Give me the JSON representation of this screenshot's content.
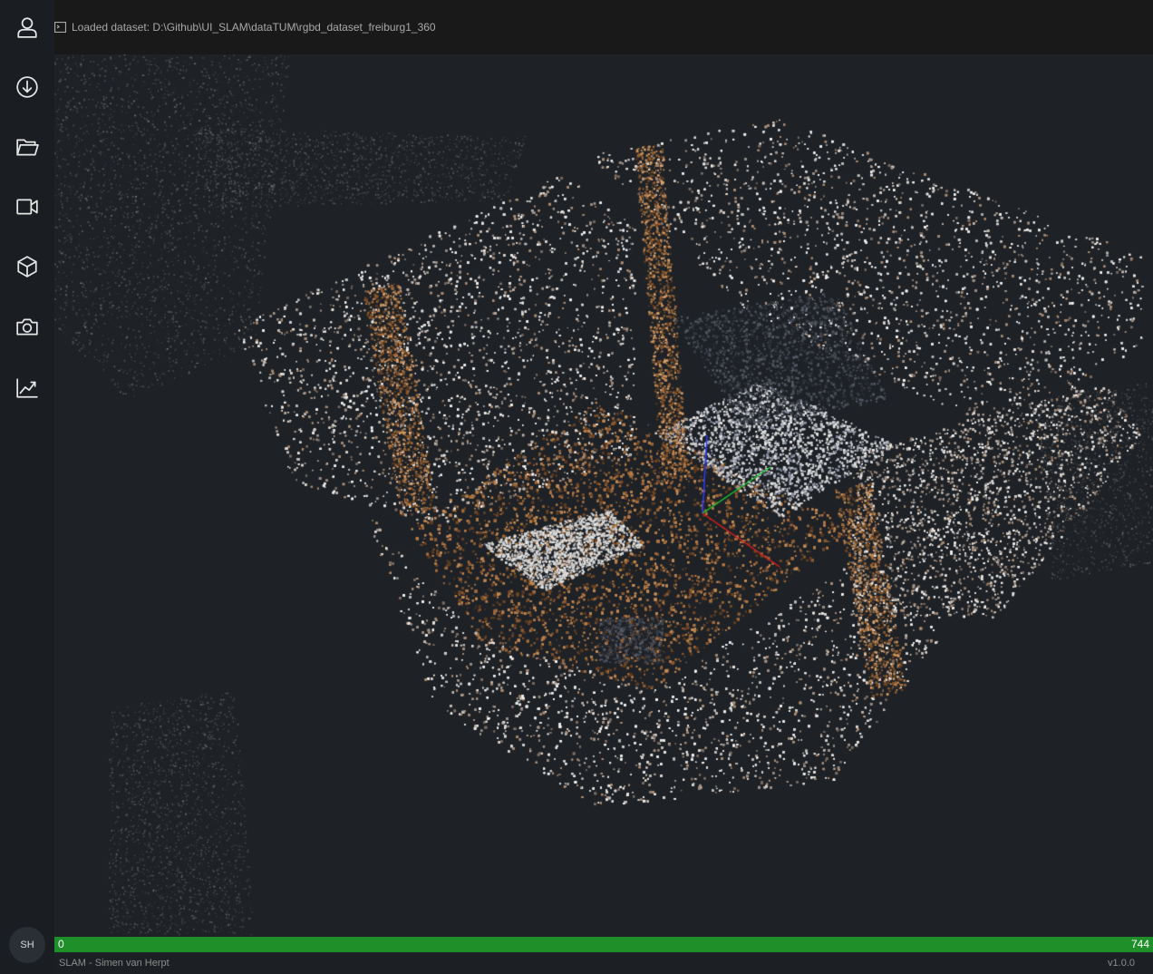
{
  "status": {
    "text": "Loaded dataset: D:\\Github\\UI_SLAM\\dataTUM\\rgbd_dataset_freiburg1_360",
    "icon": "terminal-icon"
  },
  "sidebar": {
    "items": [
      {
        "name": "user-icon"
      },
      {
        "name": "download-icon"
      },
      {
        "name": "folder-open-icon"
      },
      {
        "name": "video-camera-icon"
      },
      {
        "name": "cube-icon"
      },
      {
        "name": "camera-icon"
      },
      {
        "name": "chart-line-icon"
      }
    ]
  },
  "avatar": {
    "initials": "SH"
  },
  "progress": {
    "min": "0",
    "max": "744",
    "fraction": 1.0,
    "color": "#1f8f2a"
  },
  "footer": {
    "left": "SLAM - Simen van Herpt",
    "right": "v1.0.0"
  },
  "viewport": {
    "background": "#1e2227",
    "content": "3D point cloud reconstruction"
  }
}
